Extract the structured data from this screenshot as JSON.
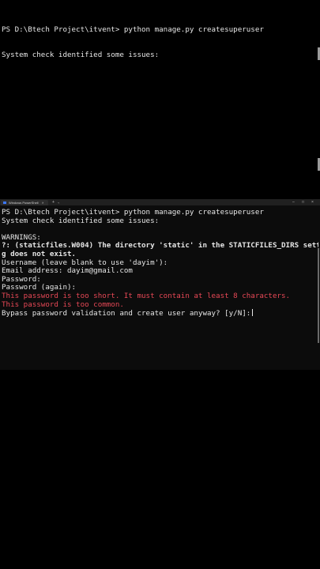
{
  "above": {
    "line1": "PS D:\\Btech Project\\itvent> python manage.py createsuperuser",
    "line2": "System check identified some issues:"
  },
  "window": {
    "tab_label": "Windows PowerShell",
    "tab_close": "×",
    "new_tab": "+",
    "dropdown": "⌄",
    "minimize": "–",
    "maximize": "□",
    "close": "×"
  },
  "console": {
    "prompt_line": "PS D:\\Btech Project\\itvent> python manage.py createsuperuser",
    "system_check": "System check identified some issues:",
    "blank": "",
    "warnings": "WARNINGS:",
    "warning_1": "?: (staticfiles.W004) The directory 'static' in the STATICFILES_DIRS settin",
    "warning_2": "g does not exist.",
    "username": "Username (leave blank to use 'dayim'):",
    "email": "Email address: dayim@gmail.com",
    "password": "Password:",
    "password_again": "Password (again):",
    "error_short": "This password is too short. It must contain at least 8 characters.",
    "error_common": "This password is too common.",
    "bypass": "Bypass password validation and create user anyway? [y/N]:"
  }
}
